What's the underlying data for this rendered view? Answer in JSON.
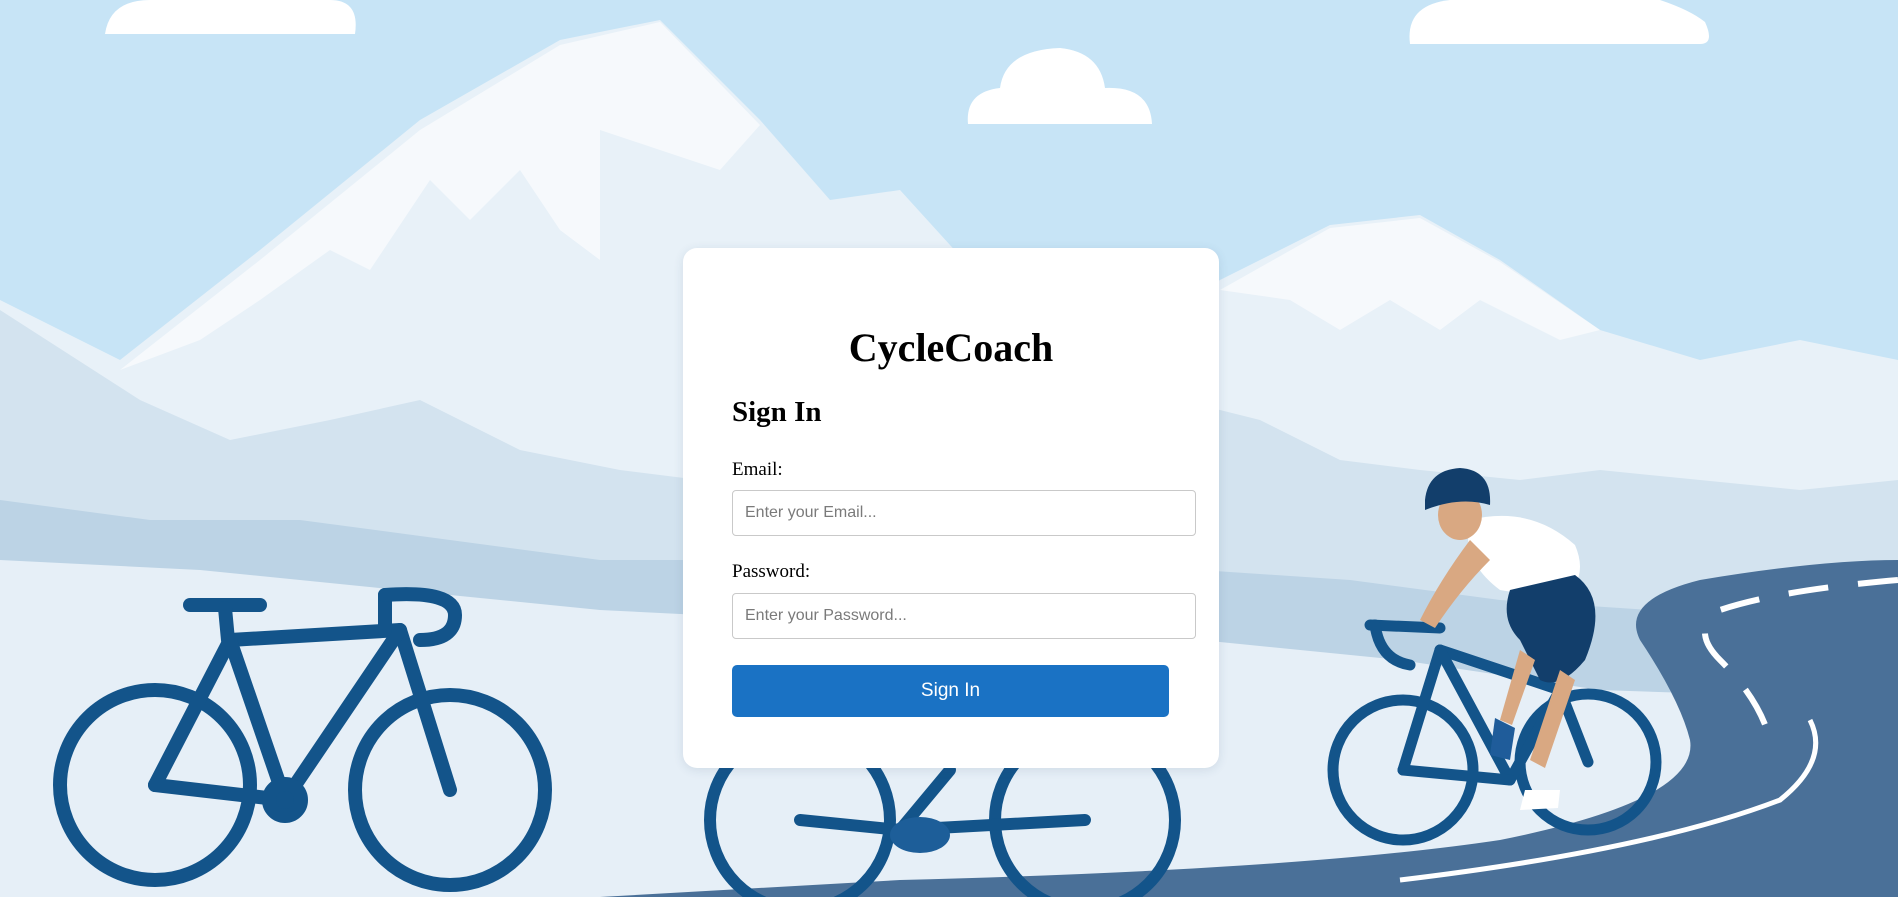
{
  "app": {
    "brand": "CycleCoach"
  },
  "form": {
    "heading": "Sign In",
    "email_label": "Email:",
    "email_placeholder": "Enter your Email...",
    "email_value": "",
    "password_label": "Password:",
    "password_placeholder": "Enter your Password...",
    "password_value": "",
    "submit_label": "Sign In"
  },
  "colors": {
    "sky": "#c7e4f6",
    "mountain_light": "#eef5fb",
    "mountain_mid": "#d4e4f0",
    "road": "#4a7098",
    "bike_blue": "#13548a",
    "button": "#1a72c4"
  },
  "background_icons": [
    "mountains-illustration",
    "parked-bicycle-icon",
    "cyclist-icon",
    "cloud-icon"
  ]
}
